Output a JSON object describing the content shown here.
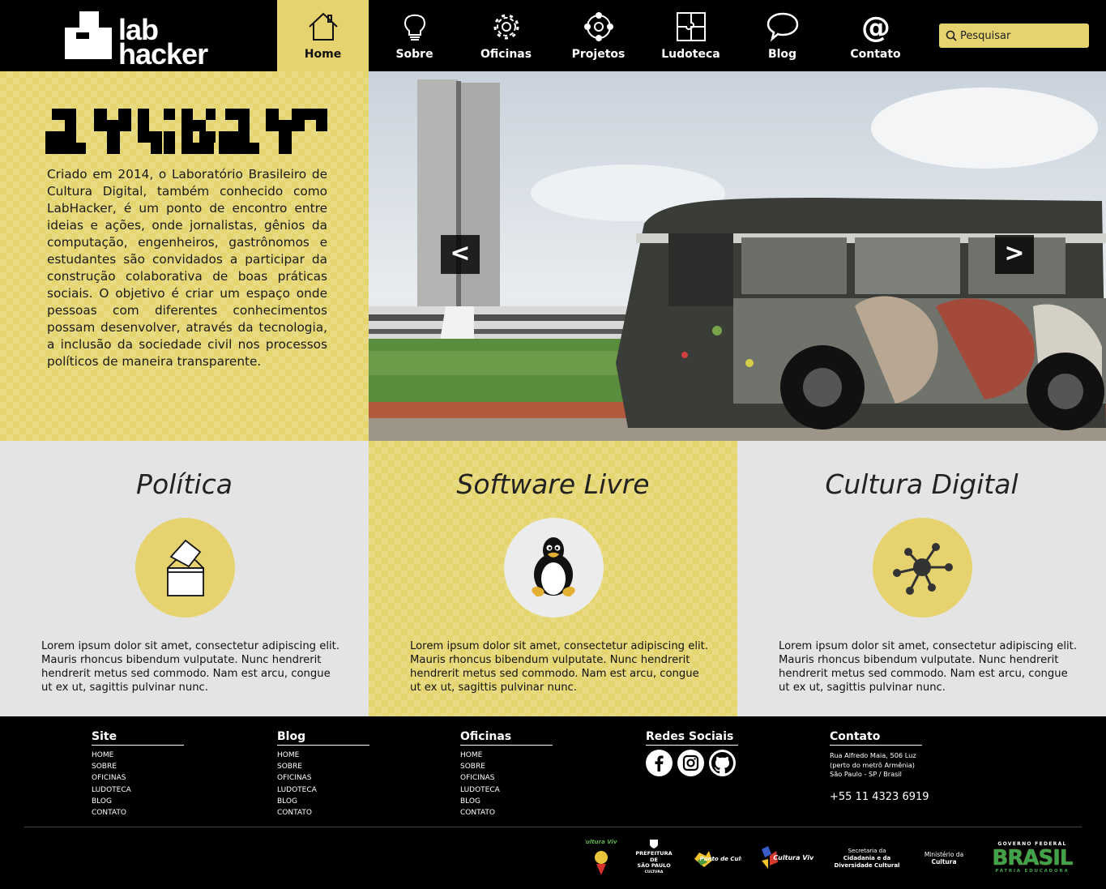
{
  "header": {
    "logo_line1": "lab",
    "logo_line2": "hacker",
    "nav": [
      {
        "label": "Home",
        "icon": "home-icon",
        "active": true
      },
      {
        "label": "Sobre",
        "icon": "lightbulb-icon"
      },
      {
        "label": "Oficinas",
        "icon": "gear-icon"
      },
      {
        "label": "Projetos",
        "icon": "network-icon"
      },
      {
        "label": "Ludoteca",
        "icon": "puzzle-icon"
      },
      {
        "label": "Blog",
        "icon": "speech-bubble-icon"
      },
      {
        "label": "Contato",
        "icon": "at-sign-icon"
      }
    ],
    "search_placeholder": "Pesquisar"
  },
  "intro": {
    "text": "Criado em 2014, o Laboratório Brasileiro de Cultura Digital, também conhecido como LabHacker, é um ponto de encontro entre ideias e ações, onde jornalistas, gênios da computação, engenheiros, gastrônomos e estudantes são convidados a participar da construção colaborativa de boas práticas sociais. O objetivo é criar um espaço onde pessoas com diferentes conhecimentos possam desenvolver, através da tecnologia, a inclusão da sociedade civil nos processos políticos de maneira transparente."
  },
  "hero": {
    "prev_label": "<",
    "next_label": ">"
  },
  "features": [
    {
      "title": "Política",
      "icon": "ballot-box-icon",
      "text": "Lorem ipsum dolor sit amet, consectetur adipiscing elit. Mauris rhoncus bibendum vulputate. Nunc hendrerit hendrerit metus sed commodo. Nam est arcu, congue ut ex ut, sagittis pulvinar nunc."
    },
    {
      "title": "Software Livre",
      "icon": "tux-penguin-icon",
      "text": "Lorem ipsum dolor sit amet, consectetur adipiscing elit. Mauris rhoncus bibendum vulputate. Nunc hendrerit hendrerit metus sed commodo. Nam est arcu, congue ut ex ut, sagittis pulvinar nunc."
    },
    {
      "title": "Cultura Digital",
      "icon": "network-hub-icon",
      "text": "Lorem ipsum dolor sit amet, consectetur adipiscing elit. Mauris rhoncus bibendum vulputate. Nunc hendrerit hendrerit metus sed commodo. Nam est arcu, congue ut ex ut, sagittis pulvinar nunc."
    }
  ],
  "footer": {
    "site": {
      "title": "Site",
      "links": [
        "HOME",
        "SOBRE",
        "OFICINAS",
        "LUDOTECA",
        "BLOG",
        "CONTATO"
      ]
    },
    "blog": {
      "title": "Blog",
      "links": [
        "HOME",
        "SOBRE",
        "OFICINAS",
        "LUDOTECA",
        "BLOG",
        "CONTATO"
      ]
    },
    "oficinas": {
      "title": "Oficinas",
      "links": [
        "HOME",
        "SOBRE",
        "OFICINAS",
        "LUDOTECA",
        "BLOG",
        "CONTATO"
      ]
    },
    "social": {
      "title": "Redes Sociais",
      "icons": [
        "facebook-icon",
        "instagram-icon",
        "github-icon"
      ]
    },
    "contato": {
      "title": "Contato",
      "address_line1": "Rua Alfredo Maia, 506 Luz",
      "address_line2": "(perto do metrô Armênia)",
      "address_line3": "São Paulo - SP / Brasil",
      "phone": "+55 11 4323 6919"
    },
    "sponsors": {
      "s1": "Cultura Viva",
      "s2a": "PREFEITURA DE",
      "s2b": "SÃO PAULO",
      "s2c": "CULTURA",
      "s3": "Ponto de Cultura",
      "s4": "Cultura Viva",
      "s5a": "Secretaria da",
      "s5b": "Cidadania e da",
      "s5c": "Diversidade Cultural",
      "s6a": "Ministério da",
      "s6b": "Cultura",
      "s7a": "GOVERNO FEDERAL",
      "s7b": "BRASIL",
      "s7c": "PÁTRIA EDUCADORA"
    }
  },
  "colors": {
    "accent": "#e6d36f",
    "grey_panel": "#e4e4e4",
    "black": "#000000"
  }
}
